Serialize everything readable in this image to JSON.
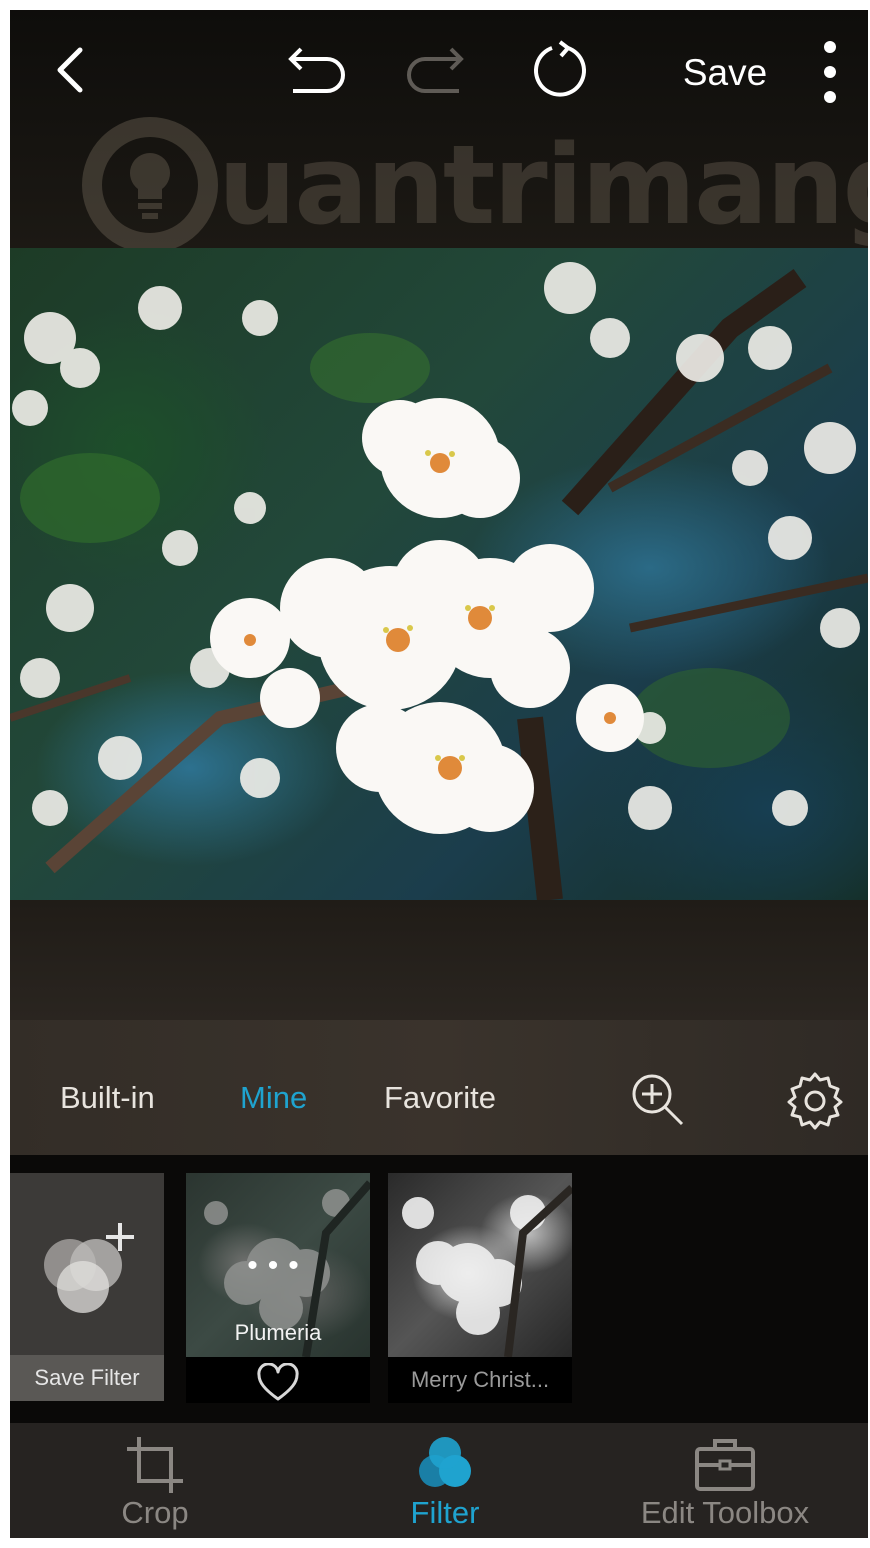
{
  "topbar": {
    "save_label": "Save",
    "watermark": "uantrimang"
  },
  "filter_tabs": [
    {
      "label": "Built-in",
      "active": false
    },
    {
      "label": "Mine",
      "active": true
    },
    {
      "label": "Favorite",
      "active": false
    }
  ],
  "filters": {
    "save_filter_label": "Save Filter",
    "items": [
      {
        "name": "Plumeria",
        "dots": "•••"
      },
      {
        "name": "Merry Christ..."
      }
    ]
  },
  "bottom_nav": [
    {
      "label": "Crop",
      "icon": "crop-icon",
      "active": false
    },
    {
      "label": "Filter",
      "icon": "filter-icon",
      "active": true
    },
    {
      "label": "Edit Toolbox",
      "icon": "toolbox-icon",
      "active": false
    }
  ],
  "colors": {
    "accent": "#1fa3cf",
    "background": "#1b1815",
    "inactive": "#8b8783"
  }
}
